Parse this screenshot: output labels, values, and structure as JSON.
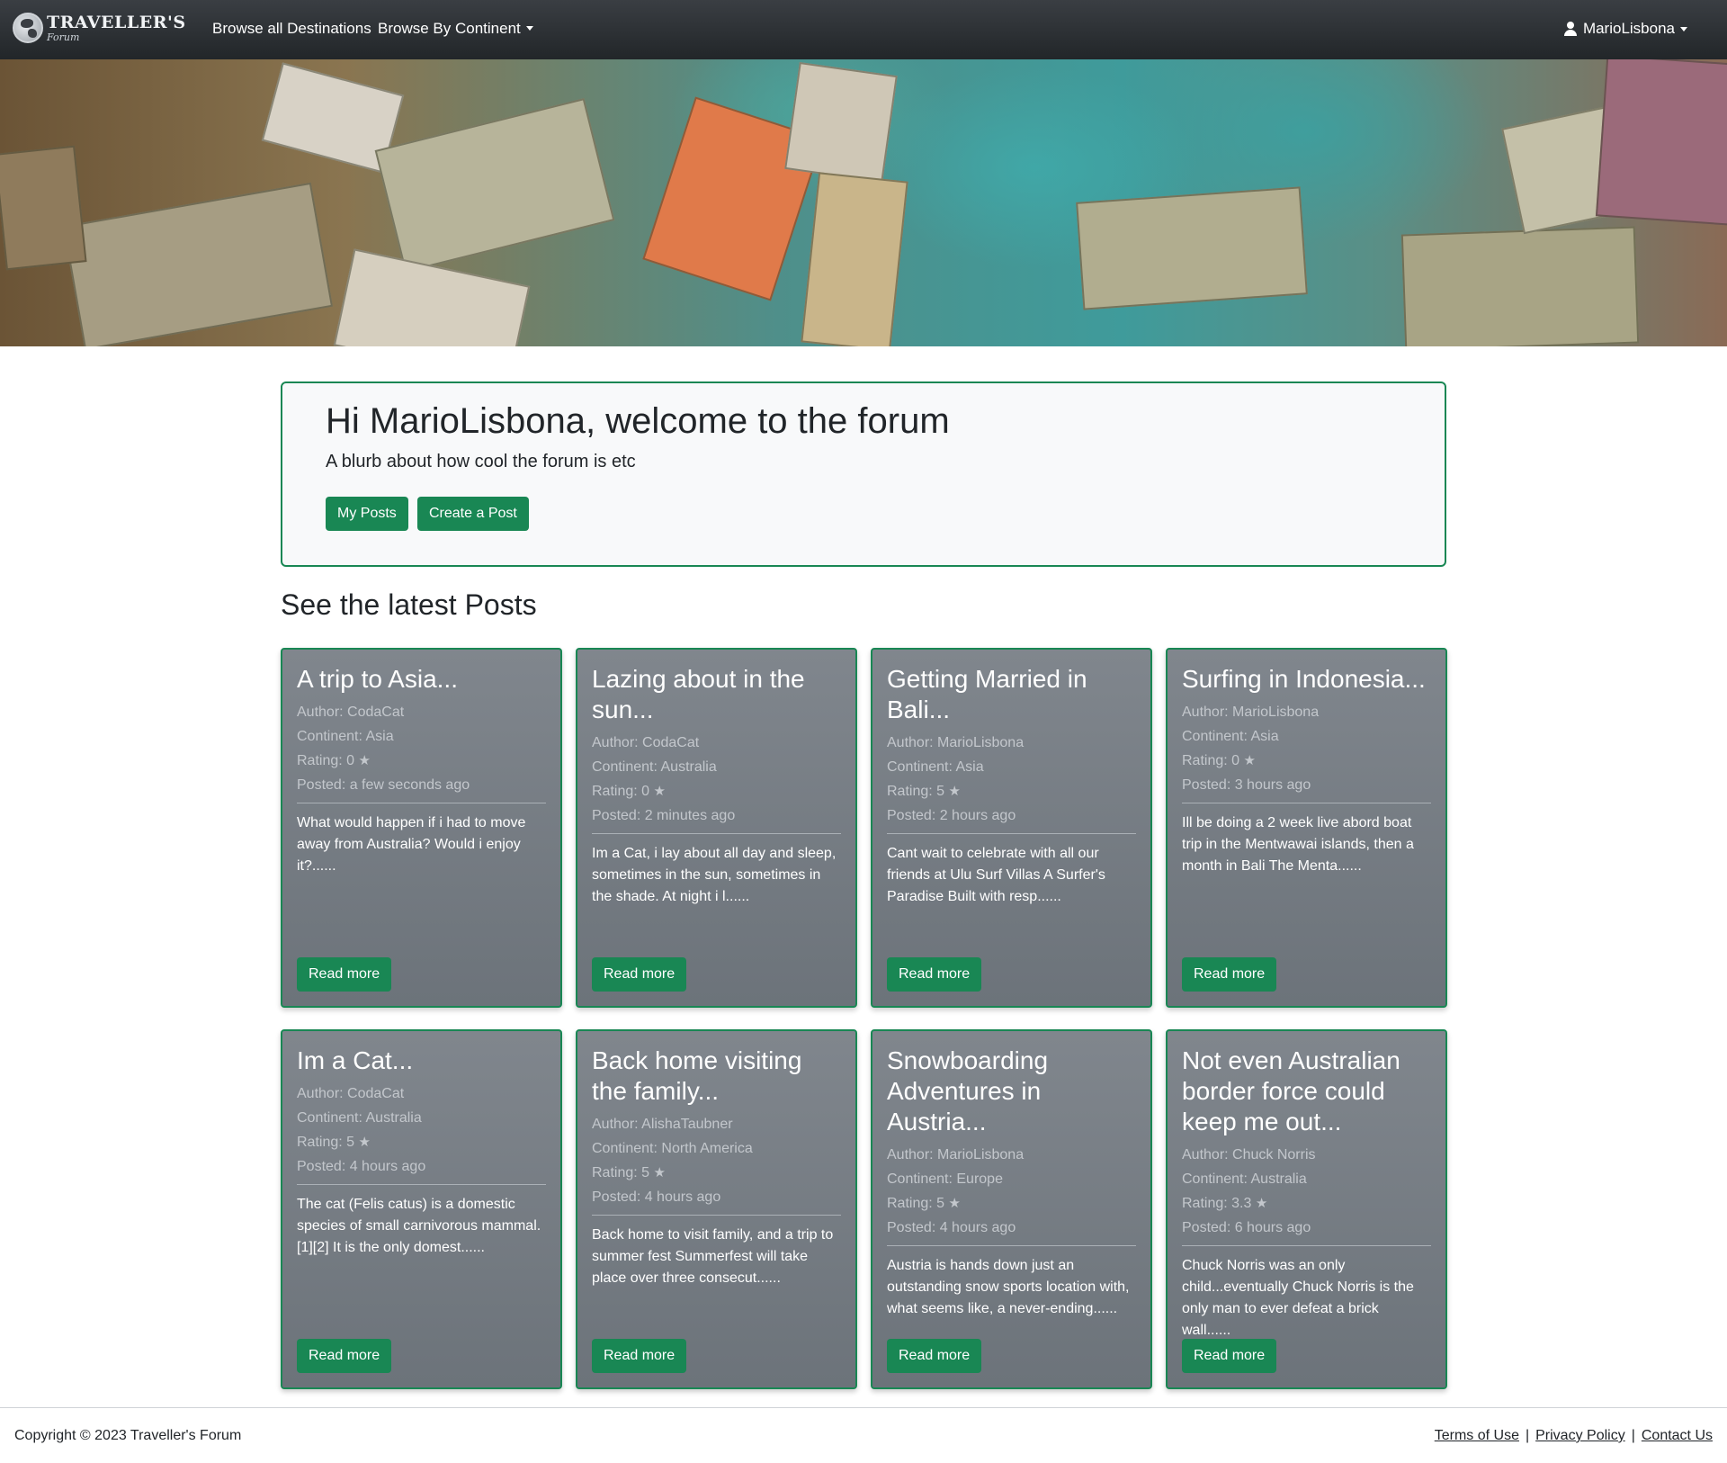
{
  "nav": {
    "brand_title": "TRAVELLER'S",
    "brand_sub": "Forum",
    "browse_all": "Browse all Destinations",
    "browse_continent": "Browse By Continent",
    "user": "MarioLisbona"
  },
  "jumbotron": {
    "title": "Hi MarioLisbona, welcome to the forum",
    "lead": "A blurb about how cool the forum is etc",
    "my_posts": "My Posts",
    "create_post": "Create a Post"
  },
  "section_title": "See the latest Posts",
  "posts": [
    {
      "title": "A trip to Asia...",
      "author": "Author: CodaCat",
      "continent": "Continent: Asia",
      "rating": "Rating: 0",
      "posted": "Posted: a few seconds ago",
      "excerpt": "What would happen if i had to move away from Australia? Would i enjoy it?......",
      "read_more": "Read more"
    },
    {
      "title": "Lazing about in the sun...",
      "author": "Author: CodaCat",
      "continent": "Continent: Australia",
      "rating": "Rating: 0",
      "posted": "Posted: 2 minutes ago",
      "excerpt": "Im a Cat, i lay about all day and sleep, sometimes in the sun, sometimes in the shade. At night i l......",
      "read_more": "Read more"
    },
    {
      "title": "Getting Married in Bali...",
      "author": "Author: MarioLisbona",
      "continent": "Continent: Asia",
      "rating": "Rating: 5",
      "posted": "Posted: 2 hours ago",
      "excerpt": "Cant wait to celebrate with all our friends at Ulu Surf Villas A Surfer's Paradise Built with resp......",
      "read_more": "Read more"
    },
    {
      "title": "Surfing in Indonesia...",
      "author": "Author: MarioLisbona",
      "continent": "Continent: Asia",
      "rating": "Rating: 0",
      "posted": "Posted: 3 hours ago",
      "excerpt": "Ill be doing a 2 week live abord boat trip in the Mentwawai islands, then a month in Bali The Menta......",
      "read_more": "Read more"
    },
    {
      "title": "Im a Cat...",
      "author": "Author: CodaCat",
      "continent": "Continent: Australia",
      "rating": "Rating: 5",
      "posted": "Posted: 4 hours ago",
      "excerpt": "The cat (Felis catus) is a domestic species of small carnivorous mammal.[1][2] It is the only domest......",
      "read_more": "Read more"
    },
    {
      "title": "Back home visiting the family...",
      "author": "Author: AlishaTaubner",
      "continent": "Continent: North America",
      "rating": "Rating: 5",
      "posted": "Posted: 4 hours ago",
      "excerpt": "Back home to visit family, and a trip to summer fest Summerfest will take place over three consecut......",
      "read_more": "Read more"
    },
    {
      "title": "Snowboarding Adventures in Austria...",
      "author": "Author: MarioLisbona",
      "continent": "Continent: Europe",
      "rating": "Rating: 5",
      "posted": "Posted: 4 hours ago",
      "excerpt": "Austria is hands down just an outstanding snow sports location with, what seems like, a never-ending......",
      "read_more": "Read more"
    },
    {
      "title": "Not even Australian border force could keep me out...",
      "author": "Author: Chuck Norris",
      "continent": "Continent: Australia",
      "rating": "Rating: 3.3",
      "posted": "Posted: 6 hours ago",
      "excerpt": "Chuck Norris was an only child...eventually Chuck Norris is the only man to ever defeat a brick wall......",
      "read_more": "Read more"
    }
  ],
  "footer": {
    "copyright": "Copyright © 2023 Traveller's Forum",
    "terms": "Terms of Use",
    "privacy": "Privacy Policy",
    "contact": "Contact Us"
  },
  "icons": {
    "star": "star-icon",
    "user": "user-icon",
    "logo": "globe-logo-icon"
  },
  "colors": {
    "accent": "#198754",
    "navbar": "#2b2f33",
    "card": "#767d84"
  }
}
